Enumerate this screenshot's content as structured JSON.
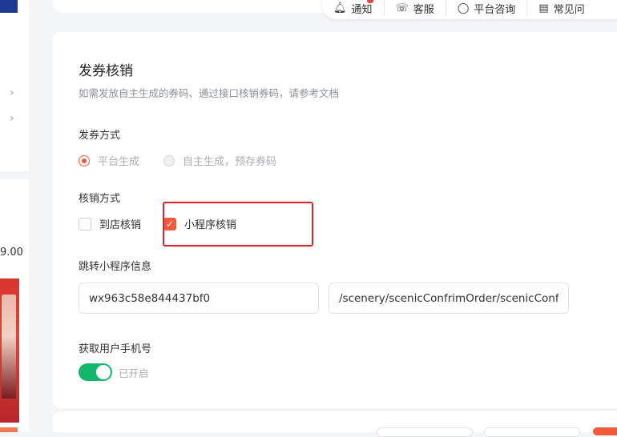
{
  "left_panel": {
    "price_fragment": "9.00"
  },
  "toolbar": {
    "items": [
      {
        "label": "通知",
        "icon": "bell-icon"
      },
      {
        "label": "客服",
        "icon": "headset-icon"
      },
      {
        "label": "平台咨询",
        "icon": "chat-icon"
      },
      {
        "label": "常见问",
        "icon": "document-icon"
      }
    ]
  },
  "form": {
    "title": "发券核销",
    "subtitle": "如需发放自主生成的券码、通过接口核销券码，请参考文档",
    "issue_method": {
      "label": "发券方式",
      "options": [
        {
          "label": "平台生成",
          "selected": true
        },
        {
          "label": "自主生成，预存券码",
          "selected": false
        }
      ]
    },
    "verify_method": {
      "label": "核销方式",
      "options": [
        {
          "label": "到店核销",
          "checked": false
        },
        {
          "label": "小程序核销",
          "checked": true
        }
      ]
    },
    "miniprogram": {
      "label": "跳转小程序信息",
      "appid": "wx963c58e844437bf0",
      "path": "/scenery/scenicConfrimOrder/scenicConfrimOrder"
    },
    "phone": {
      "label": "获取用户手机号",
      "enabled": true,
      "status": "已开启"
    }
  },
  "colors": {
    "accent": "#f15a3a",
    "switch_on": "#12b76a",
    "highlight": "#e0232a"
  }
}
